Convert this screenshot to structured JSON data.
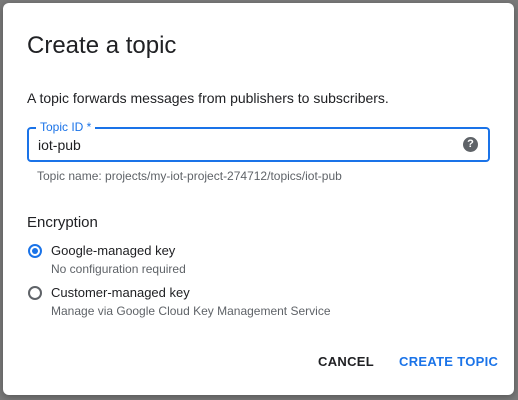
{
  "dialog": {
    "title": "Create a topic",
    "description": "A topic forwards messages from publishers to subscribers."
  },
  "topic_field": {
    "label": "Topic ID *",
    "value": "iot-pub",
    "help_icon": "help-icon",
    "hint": "Topic name: projects/my-iot-project-274712/topics/iot-pub"
  },
  "encryption": {
    "heading": "Encryption",
    "options": [
      {
        "label": "Google-managed key",
        "sublabel": "No configuration required",
        "selected": true
      },
      {
        "label": "Customer-managed key",
        "sublabel": "Manage via Google Cloud Key Management Service",
        "selected": false
      }
    ]
  },
  "actions": {
    "cancel_label": "CANCEL",
    "create_label": "CREATE TOPIC"
  },
  "colors": {
    "accent": "#1a73e8",
    "text": "#202124",
    "secondary_text": "#5f6368"
  }
}
